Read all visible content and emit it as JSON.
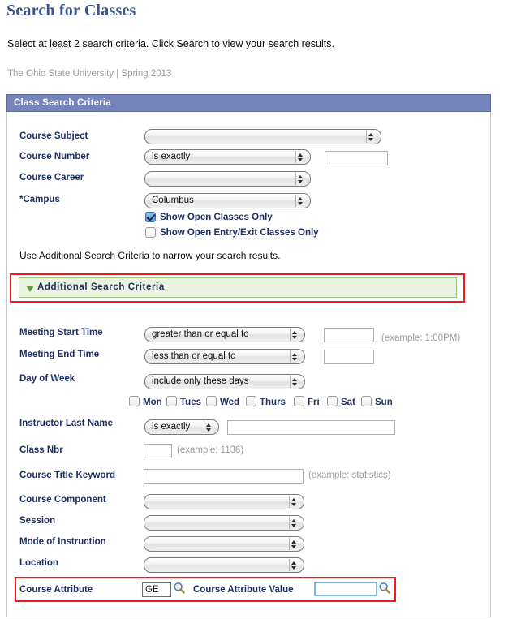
{
  "page": {
    "title": "Search for Classes",
    "instructions": "Select at least 2 search criteria. Click Search to view your search results.",
    "term_line": "The Ohio State University | Spring 2013",
    "accent_color": "#3d5389",
    "panel_header_color": "#7585bc",
    "label_color": "#1d3064",
    "highlight_color": "#ee1c18",
    "green_bar_color": "#eaf2e0"
  },
  "class_search": {
    "section_title": "Class Search Criteria",
    "course_subject": {
      "label": "Course Subject",
      "value": ""
    },
    "course_number": {
      "label": "Course Number",
      "operator": "is exactly",
      "value": ""
    },
    "course_career": {
      "label": "Course Career",
      "value": ""
    },
    "campus": {
      "label": "*Campus",
      "value": "Columbus"
    },
    "show_open_classes": {
      "label": "Show Open Classes Only",
      "checked": "true"
    },
    "show_open_entry_exit": {
      "label": "Show Open Entry/Exit Classes Only",
      "checked": "false"
    },
    "additional_note": "Use Additional Search Criteria to narrow your search results."
  },
  "additional_search": {
    "section_title": "Additional Search Criteria",
    "meeting_start_time": {
      "label": "Meeting Start Time",
      "operator": "greater than or equal to",
      "value": "",
      "hint": "(example: 1:00PM)"
    },
    "meeting_end_time": {
      "label": "Meeting End Time",
      "operator": "less than or equal to",
      "value": ""
    },
    "day_of_week": {
      "label": "Day of Week",
      "operator": "include only these days"
    },
    "days": [
      {
        "label": "Mon",
        "checked": "false"
      },
      {
        "label": "Tues",
        "checked": "false"
      },
      {
        "label": "Wed",
        "checked": "false"
      },
      {
        "label": "Thurs",
        "checked": "false"
      },
      {
        "label": "Fri",
        "checked": "false"
      },
      {
        "label": "Sat",
        "checked": "false"
      },
      {
        "label": "Sun",
        "checked": "false"
      }
    ],
    "instructor_last_name": {
      "label": "Instructor Last Name",
      "operator": "is exactly",
      "value": ""
    },
    "class_nbr": {
      "label": "Class Nbr",
      "value": "",
      "hint": "(example: 1136)"
    },
    "course_title_keyword": {
      "label": "Course Title Keyword",
      "value": "",
      "hint": "(example: statistics)"
    },
    "course_component": {
      "label": "Course Component",
      "value": ""
    },
    "session": {
      "label": "Session",
      "value": ""
    },
    "mode_of_instruction": {
      "label": "Mode of Instruction",
      "value": ""
    },
    "location": {
      "label": "Location",
      "value": ""
    },
    "course_attribute": {
      "label": "Course Attribute",
      "value": "GE"
    },
    "course_attribute_value": {
      "label": "Course Attribute Value",
      "value": ""
    }
  }
}
